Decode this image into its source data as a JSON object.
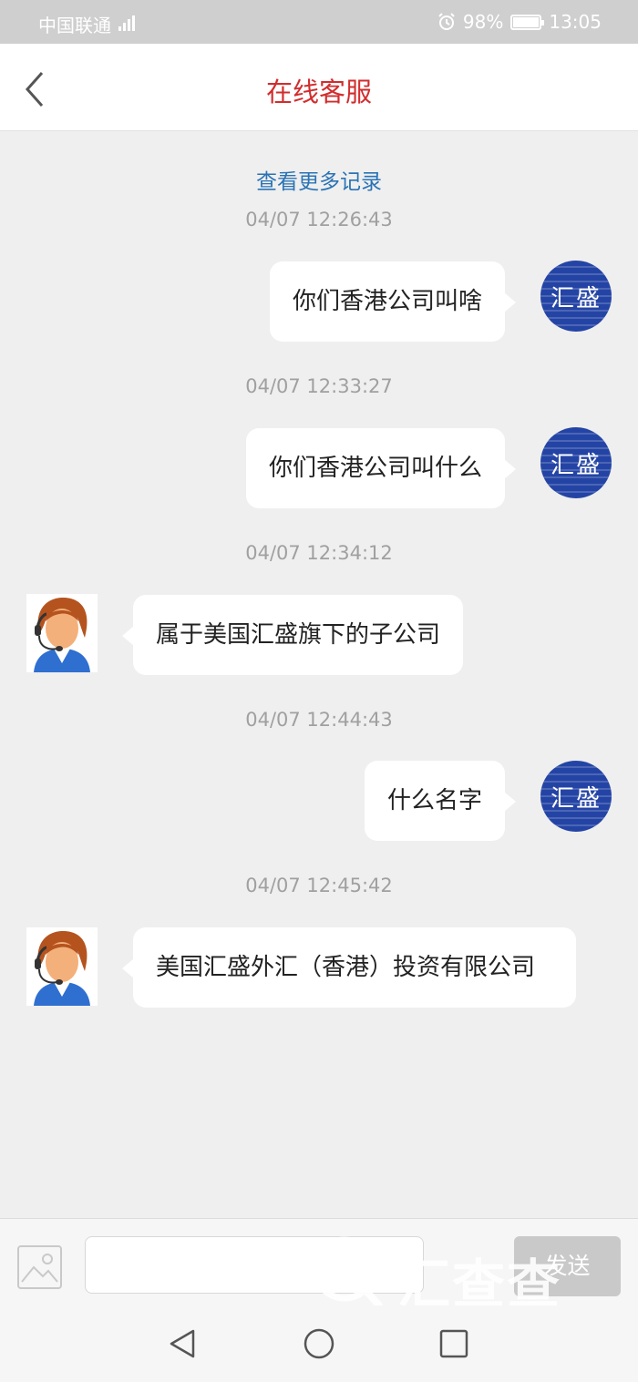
{
  "status_bar": {
    "carrier": "中国联通",
    "battery": "98%",
    "battery_level": 0.98,
    "time": "13:05"
  },
  "nav": {
    "title": "在线客服"
  },
  "chat": {
    "load_more": "查看更多记录",
    "messages": [
      {
        "time": "04/07 12:26:43",
        "sender": "user",
        "text": "你们香港公司叫啥"
      },
      {
        "time": "04/07 12:33:27",
        "sender": "user",
        "text": "你们香港公司叫什么"
      },
      {
        "time": "04/07 12:34:12",
        "sender": "agent",
        "text": "属于美国汇盛旗下的子公司"
      },
      {
        "time": "04/07 12:44:43",
        "sender": "user",
        "text": "什么名字"
      },
      {
        "time": "04/07 12:45:42",
        "sender": "agent",
        "text": "美国汇盛外汇（香港）投资有限公司"
      }
    ],
    "user_avatar_text": "汇盛"
  },
  "composer": {
    "input_value": "",
    "send_label": "发送"
  },
  "watermark": "汇查查",
  "colors": {
    "title_red": "#d22d2d",
    "link_blue": "#2b73b5",
    "avatar_blue": "#2444a5",
    "background": "#efefef"
  },
  "icons": {
    "back": "chevron-left-icon",
    "image": "image-icon",
    "nav_back": "triangle-back-icon",
    "nav_home": "circle-home-icon",
    "nav_recents": "square-recents-icon"
  }
}
